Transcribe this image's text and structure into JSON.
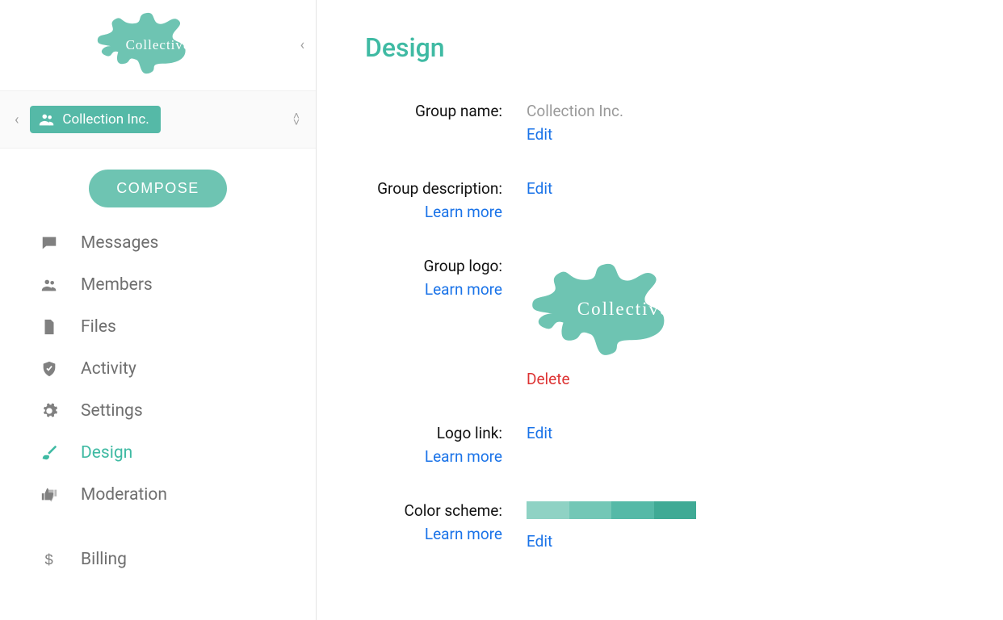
{
  "brand": {
    "name": "Collective"
  },
  "group_bar": {
    "name": "Collection Inc."
  },
  "compose_label": "COMPOSE",
  "sidebar_items": [
    {
      "id": "messages",
      "label": "Messages",
      "icon": "chat"
    },
    {
      "id": "members",
      "label": "Members",
      "icon": "people"
    },
    {
      "id": "files",
      "label": "Files",
      "icon": "file"
    },
    {
      "id": "activity",
      "label": "Activity",
      "icon": "shield"
    },
    {
      "id": "settings",
      "label": "Settings",
      "icon": "gear"
    },
    {
      "id": "design",
      "label": "Design",
      "icon": "brush",
      "active": true
    },
    {
      "id": "moderation",
      "label": "Moderation",
      "icon": "thumbs"
    }
  ],
  "sidebar_extra": {
    "id": "billing",
    "label": "Billing",
    "icon": "dollar"
  },
  "page": {
    "title": "Design",
    "group_name": {
      "label": "Group name:",
      "value": "Collection Inc.",
      "edit": "Edit"
    },
    "group_description": {
      "label": "Group description:",
      "learn": "Learn more",
      "edit": "Edit"
    },
    "group_logo": {
      "label": "Group logo:",
      "learn": "Learn more",
      "logo_text": "Collective",
      "delete": "Delete"
    },
    "logo_link": {
      "label": "Logo link:",
      "learn": "Learn more",
      "edit": "Edit"
    },
    "color_scheme": {
      "label": "Color scheme:",
      "learn": "Learn more",
      "edit": "Edit",
      "swatches": [
        "#8fd2c4",
        "#73c7b6",
        "#55b9a7",
        "#3faa95"
      ]
    }
  },
  "icons": {
    "chevron_left": "‹",
    "chevron_up": "˄",
    "chevron_down": "˅"
  }
}
